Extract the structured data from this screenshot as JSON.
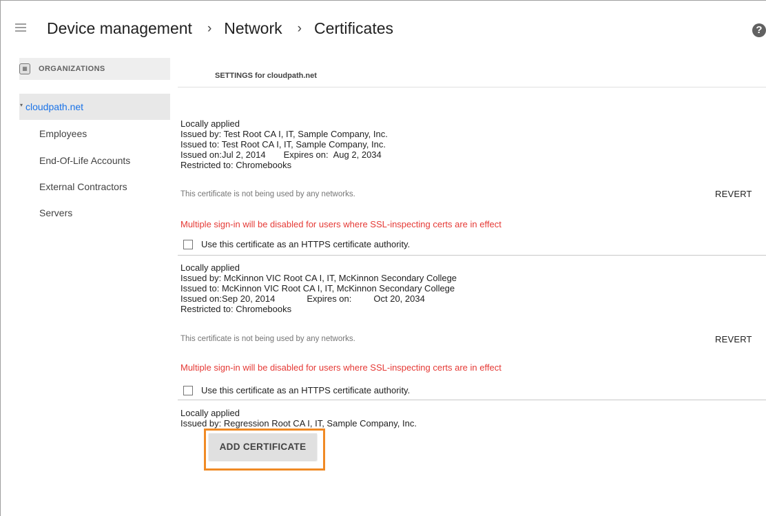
{
  "header": {
    "breadcrumbs": [
      "Device management",
      "Network",
      "Certificates"
    ],
    "separator": "›",
    "help_symbol": "?"
  },
  "sidebar": {
    "title": "ORGANIZATIONS",
    "root": {
      "name": "cloudpath.net",
      "expanded_symbol": "▾"
    },
    "children": [
      "Employees",
      "End-Of-Life Accounts",
      "External Contractors",
      "Servers"
    ]
  },
  "main": {
    "settings_label": "SETTINGS for cloudpath.net",
    "certificates": [
      {
        "status": "Locally applied",
        "issued_by": "Issued by: Test Root CA I, IT, Sample Company, Inc.",
        "issued_to": "Issued to: Test Root CA I, IT, Sample Company, Inc.",
        "issued_on": "Issued on:Jul 2, 2014",
        "expires_label": "Expires on:",
        "expires_value": "Aug 2, 2034",
        "restricted": "Restricted to: Chromebooks",
        "usage_note": "This certificate is not being used by any networks.",
        "revert_label": "REVERT",
        "warning": "Multiple sign-in will be disabled for users where SSL-inspecting certs are in effect",
        "https_label": "Use this certificate as an HTTPS certificate authority."
      },
      {
        "status": "Locally applied",
        "issued_by": "Issued by: McKinnon VIC Root CA I, IT, McKinnon Secondary College",
        "issued_to": "Issued to: McKinnon VIC Root CA I, IT, McKinnon Secondary College",
        "issued_on": "Issued on:Sep 20, 2014",
        "expires_label": "Expires on:",
        "expires_value": "Oct 20, 2034",
        "restricted": "Restricted to: Chromebooks",
        "usage_note": "This certificate is not being used by any networks.",
        "revert_label": "REVERT",
        "warning": "Multiple sign-in will be disabled for users where SSL-inspecting certs are in effect",
        "https_label": "Use this certificate as an HTTPS certificate authority."
      },
      {
        "status": "Locally applied",
        "issued_by": "Issued by: Regression Root CA I, IT, Sample Company, Inc."
      }
    ],
    "add_button_label": "ADD CERTIFICATE",
    "highlight_color": "#f08a24"
  }
}
